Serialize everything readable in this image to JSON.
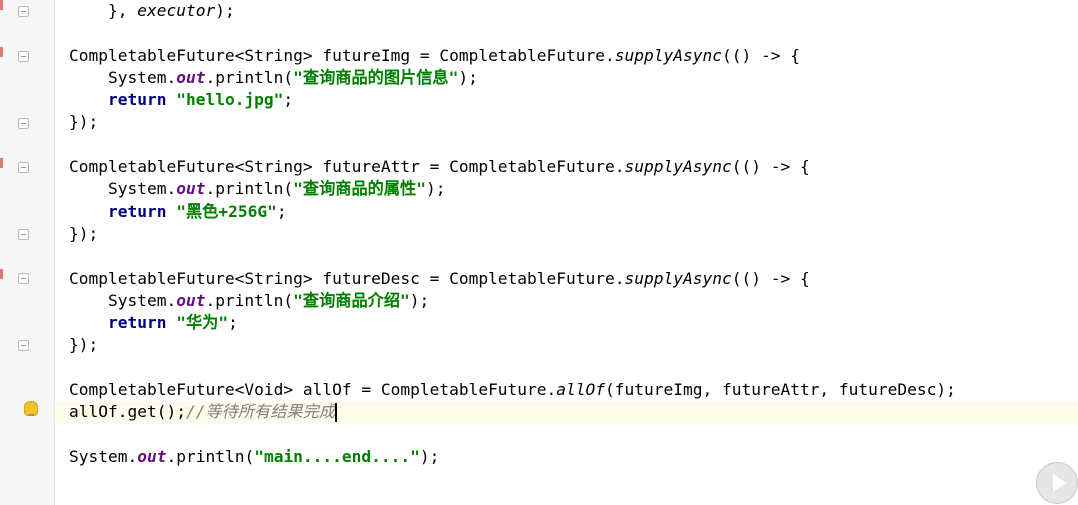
{
  "lines": [
    {
      "parts": [
        {
          "t": "    }, ",
          "c": "pl"
        },
        {
          "t": "executor",
          "c": "it"
        },
        {
          "t": ");",
          "c": "pl"
        }
      ]
    },
    {
      "parts": []
    },
    {
      "parts": [
        {
          "t": "CompletableFuture<String> futureImg = CompletableFuture.",
          "c": "pl"
        },
        {
          "t": "supplyAsync",
          "c": "it"
        },
        {
          "t": "(() -> {",
          "c": "pl"
        }
      ]
    },
    {
      "parts": [
        {
          "t": "    System.",
          "c": "pl"
        },
        {
          "t": "out",
          "c": "st"
        },
        {
          "t": ".println(",
          "c": "pl"
        },
        {
          "t": "\"查询商品的图片信息\"",
          "c": "str"
        },
        {
          "t": ");",
          "c": "pl"
        }
      ]
    },
    {
      "parts": [
        {
          "t": "    ",
          "c": "pl"
        },
        {
          "t": "return",
          "c": "kw"
        },
        {
          "t": " ",
          "c": "pl"
        },
        {
          "t": "\"hello.jpg\"",
          "c": "str"
        },
        {
          "t": ";",
          "c": "pl"
        }
      ]
    },
    {
      "parts": [
        {
          "t": "});",
          "c": "pl"
        }
      ]
    },
    {
      "parts": []
    },
    {
      "parts": [
        {
          "t": "CompletableFuture<String> futureAttr = CompletableFuture.",
          "c": "pl"
        },
        {
          "t": "supplyAsync",
          "c": "it"
        },
        {
          "t": "(() -> {",
          "c": "pl"
        }
      ]
    },
    {
      "parts": [
        {
          "t": "    System.",
          "c": "pl"
        },
        {
          "t": "out",
          "c": "st"
        },
        {
          "t": ".println(",
          "c": "pl"
        },
        {
          "t": "\"查询商品的属性\"",
          "c": "str"
        },
        {
          "t": ");",
          "c": "pl"
        }
      ]
    },
    {
      "parts": [
        {
          "t": "    ",
          "c": "pl"
        },
        {
          "t": "return",
          "c": "kw"
        },
        {
          "t": " ",
          "c": "pl"
        },
        {
          "t": "\"黑色+256G\"",
          "c": "str"
        },
        {
          "t": ";",
          "c": "pl"
        }
      ]
    },
    {
      "parts": [
        {
          "t": "});",
          "c": "pl"
        }
      ]
    },
    {
      "parts": []
    },
    {
      "parts": [
        {
          "t": "CompletableFuture<String> futureDesc = CompletableFuture.",
          "c": "pl"
        },
        {
          "t": "supplyAsync",
          "c": "it"
        },
        {
          "t": "(() -> {",
          "c": "pl"
        }
      ]
    },
    {
      "parts": [
        {
          "t": "    System.",
          "c": "pl"
        },
        {
          "t": "out",
          "c": "st"
        },
        {
          "t": ".println(",
          "c": "pl"
        },
        {
          "t": "\"查询商品介绍\"",
          "c": "str"
        },
        {
          "t": ");",
          "c": "pl"
        }
      ]
    },
    {
      "parts": [
        {
          "t": "    ",
          "c": "pl"
        },
        {
          "t": "return",
          "c": "kw"
        },
        {
          "t": " ",
          "c": "pl"
        },
        {
          "t": "\"华为\"",
          "c": "str"
        },
        {
          "t": ";",
          "c": "pl"
        }
      ]
    },
    {
      "parts": [
        {
          "t": "});",
          "c": "pl"
        }
      ]
    },
    {
      "parts": []
    },
    {
      "parts": [
        {
          "t": "CompletableFuture<Void> allOf = CompletableFuture.",
          "c": "pl"
        },
        {
          "t": "allOf",
          "c": "it"
        },
        {
          "t": "(futureImg, futureAttr, futureDesc);",
          "c": "pl"
        }
      ]
    },
    {
      "parts": [
        {
          "t": "allOf.get();",
          "c": "pl"
        },
        {
          "t": "//等待所有结果完成",
          "c": "cm"
        }
      ],
      "caret": true
    },
    {
      "parts": []
    },
    {
      "parts": [
        {
          "t": "System.",
          "c": "pl"
        },
        {
          "t": "out",
          "c": "st"
        },
        {
          "t": ".println(",
          "c": "pl"
        },
        {
          "t": "\"main....end....\"",
          "c": "str"
        },
        {
          "t": ");",
          "c": "pl"
        }
      ]
    }
  ],
  "icons": {
    "intention_bulb": "lightbulb-icon",
    "fold_markers": "fold-marker-icon",
    "play": "play-icon"
  },
  "colors": {
    "keyword": "#000080",
    "string": "#008000",
    "static_field": "#660e7a",
    "comment": "#808080",
    "current_line": "#fdfbe9",
    "gutter": "#f6f6f6"
  }
}
